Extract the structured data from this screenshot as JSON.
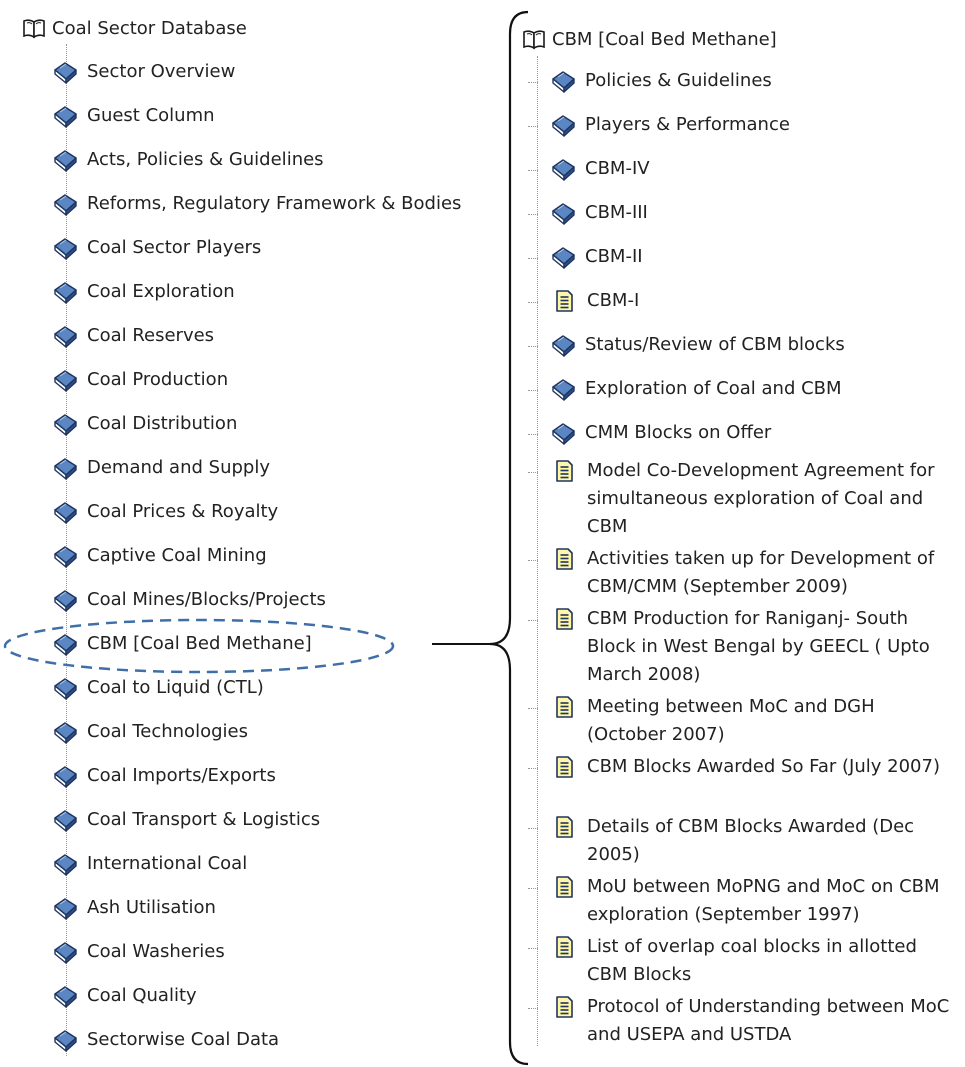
{
  "left_tree": {
    "root_label": "Coal Sector Database",
    "items": [
      {
        "label": "Sector Overview"
      },
      {
        "label": "Guest Column"
      },
      {
        "label": "Acts, Policies & Guidelines"
      },
      {
        "label": "Reforms, Regulatory Framework & Bodies"
      },
      {
        "label": "Coal Sector Players"
      },
      {
        "label": "Coal Exploration"
      },
      {
        "label": "Coal Reserves"
      },
      {
        "label": "Coal Production"
      },
      {
        "label": "Coal Distribution"
      },
      {
        "label": "Demand and Supply"
      },
      {
        "label": "Coal Prices & Royalty"
      },
      {
        "label": "Captive Coal Mining"
      },
      {
        "label": "Coal Mines/Blocks/Projects"
      },
      {
        "label": "CBM [Coal Bed Methane]"
      },
      {
        "label": "Coal to Liquid (CTL)"
      },
      {
        "label": "Coal Technologies"
      },
      {
        "label": "Coal Imports/Exports"
      },
      {
        "label": "Coal Transport & Logistics"
      },
      {
        "label": "International Coal"
      },
      {
        "label": "Ash Utilisation"
      },
      {
        "label": "Coal Washeries"
      },
      {
        "label": "Coal Quality"
      },
      {
        "label": "Sectorwise Coal Data"
      }
    ]
  },
  "right_tree": {
    "root_label": "CBM [Coal Bed Methane]",
    "items": [
      {
        "label": "Policies & Guidelines",
        "icon": "book"
      },
      {
        "label": "Players & Performance",
        "icon": "book"
      },
      {
        "label": "CBM-IV",
        "icon": "book"
      },
      {
        "label": "CBM-III",
        "icon": "book"
      },
      {
        "label": "CBM-II",
        "icon": "book"
      },
      {
        "label": "CBM-I",
        "icon": "doc"
      },
      {
        "label": "Status/Review of CBM blocks",
        "icon": "book"
      },
      {
        "label": "Exploration of Coal and CBM",
        "icon": "book"
      },
      {
        "label": "CMM Blocks on Offer",
        "icon": "book"
      },
      {
        "label": "Model Co-Development Agreement for simultaneous exploration of Coal and CBM",
        "icon": "doc"
      },
      {
        "label": "Activities taken up for Development of CBM/CMM (September 2009)",
        "icon": "doc"
      },
      {
        "label": "CBM Production for Raniganj- South Block in West Bengal by GEECL ( Upto March 2008)",
        "icon": "doc"
      },
      {
        "label": "Meeting between MoC and DGH (October 2007)",
        "icon": "doc"
      },
      {
        "label": "CBM Blocks Awarded So Far (July 2007)",
        "icon": "doc"
      },
      {
        "label": "Details of CBM Blocks Awarded (Dec 2005)",
        "icon": "doc"
      },
      {
        "label": "MoU between MoPNG and MoC on CBM exploration (September 1997)",
        "icon": "doc"
      },
      {
        "label": "List of overlap coal blocks in allotted CBM Blocks",
        "icon": "doc"
      },
      {
        "label": "Protocol of Understanding between MoC and USEPA and USTDA",
        "icon": "doc"
      }
    ]
  },
  "colors": {
    "book_blue": "#5a86c4",
    "book_dark": "#1f3560",
    "doc_yellow": "#fff6a8",
    "highlight_dash": "#3f6fa8",
    "bracket": "#111111",
    "tree_line": "#9a9a9a"
  },
  "icons": {
    "root": "open-book-icon",
    "closed": "closed-book-icon",
    "document": "document-icon"
  }
}
